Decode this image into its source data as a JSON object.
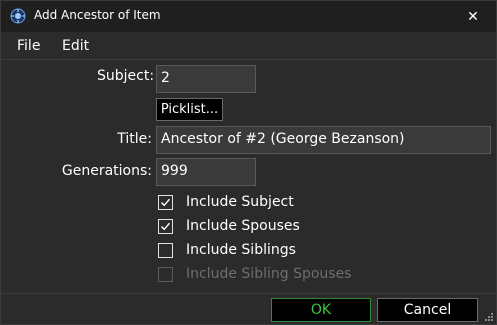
{
  "window": {
    "title": "Add Ancestor of Item",
    "close_glyph": "✕"
  },
  "menu": {
    "items": [
      {
        "label": "File"
      },
      {
        "label": "Edit"
      }
    ]
  },
  "form": {
    "subject_label": "Subject:",
    "subject_value": "2",
    "picklist_label": "Picklist...",
    "title_label": "Title:",
    "title_value": "Ancestor of #2 (George Bezanson)",
    "generations_label": "Generations:",
    "generations_value": "999",
    "options": [
      {
        "label": "Include Subject",
        "checked": true,
        "enabled": true
      },
      {
        "label": "Include Spouses",
        "checked": true,
        "enabled": true
      },
      {
        "label": "Include Siblings",
        "checked": false,
        "enabled": true
      },
      {
        "label": "Include Sibling Spouses",
        "checked": false,
        "enabled": false
      }
    ]
  },
  "buttons": {
    "ok_label": "OK",
    "cancel_label": "Cancel"
  },
  "colors": {
    "ok_text": "#3ec43e",
    "ok_border": "#2e8b2e",
    "background": "#2b2b2b",
    "titlebar": "#1f1f1f"
  }
}
